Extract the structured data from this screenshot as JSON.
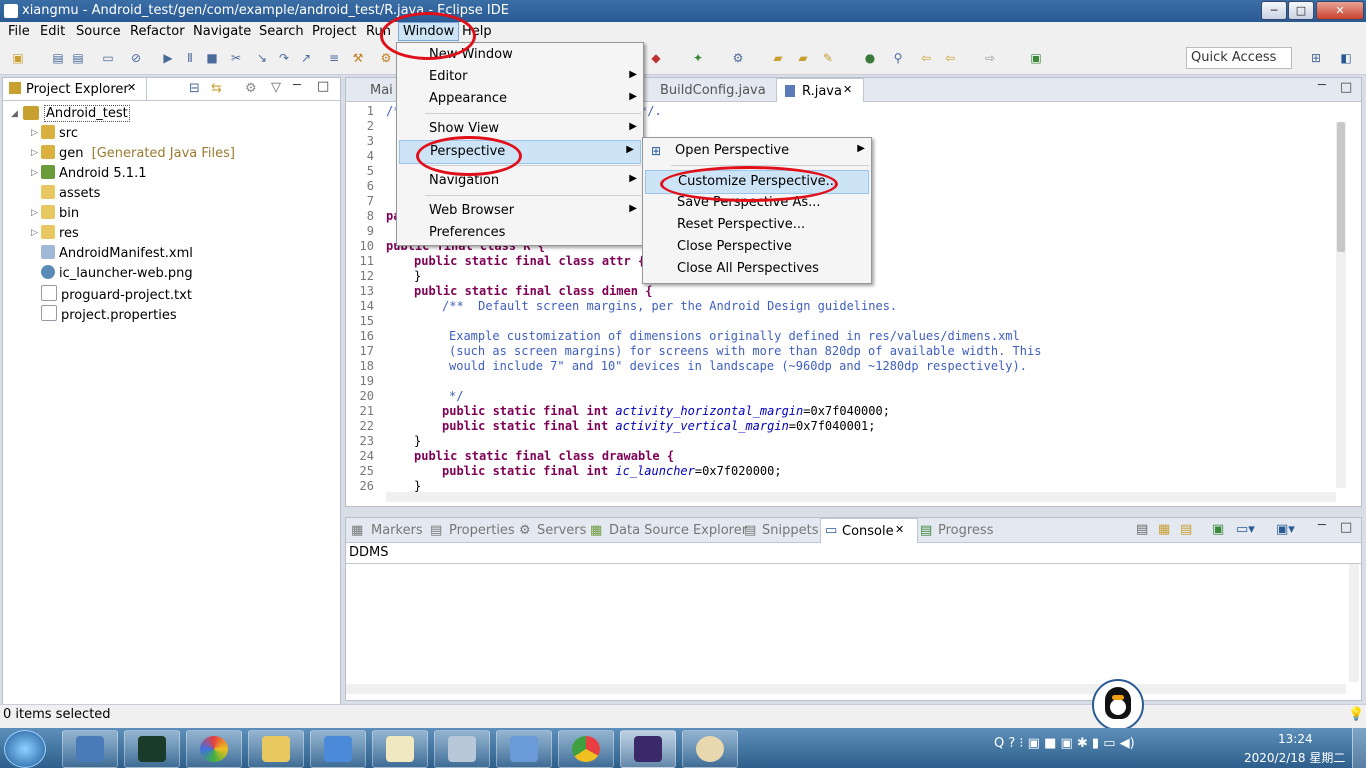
{
  "window": {
    "title": "xiangmu - Android_test/gen/com/example/android_test/R.java - Eclipse IDE",
    "minimize": "─",
    "maximize": "□",
    "close": "✕"
  },
  "menubar": [
    "File",
    "Edit",
    "Source",
    "Refactor",
    "Navigate",
    "Search",
    "Project",
    "Run",
    "Window",
    "Help"
  ],
  "toolbar": {
    "quick_access": "Quick Access"
  },
  "project_explorer": {
    "title": "Project Explorer",
    "project": "Android_test",
    "items": [
      {
        "label": "src",
        "extra": ""
      },
      {
        "label": "gen",
        "extra": "[Generated Java Files]"
      },
      {
        "label": "Android 5.1.1",
        "extra": ""
      },
      {
        "label": "assets",
        "extra": ""
      },
      {
        "label": "bin",
        "extra": ""
      },
      {
        "label": "res",
        "extra": ""
      },
      {
        "label": "AndroidManifest.xml",
        "extra": ""
      },
      {
        "label": "ic_launcher-web.png",
        "extra": ""
      },
      {
        "label": "proguard-project.txt",
        "extra": ""
      },
      {
        "label": "project.properties",
        "extra": ""
      }
    ]
  },
  "editor": {
    "tabs": [
      "Mai",
      "BuildConfig.java",
      "R.java"
    ],
    "line_numbers": [
      "1",
      "2",
      "3",
      "4",
      "5",
      "6",
      "7",
      "8",
      "9",
      "10",
      "11",
      "12",
      "13",
      "14",
      "15",
      "16",
      "17",
      "18",
      "19",
      "20",
      "21",
      "22",
      "23",
      "24",
      "25",
      "26"
    ],
    "lines": {
      "l1": "/**",
      "l1b": "*/.",
      "l8": "pa",
      "l10": "public final class R {",
      "l11": "public static final class attr {",
      "l12": "}",
      "l13": "public static final class dimen {",
      "l14": "/**  Default screen margins, per the Android Design guidelines.",
      "l16": "Example customization of dimensions originally defined in res/values/dimens.xml",
      "l17": "(such as screen margins) for screens with more than 820dp of available width. This",
      "l18": "would include 7\" and 10\" devices in landscape (~960dp and ~1280dp respectively).",
      "l20": "*/",
      "l21_field": "activity_horizontal_margin",
      "l21_val": "=0x7f040000;",
      "l22_field": "activity_vertical_margin",
      "l22_val": "=0x7f040001;",
      "l23": "}",
      "l24": "public static final class drawable {",
      "l25_field": "ic_launcher",
      "l25_val": "=0x7f020000;",
      "l26": "}",
      "kw_psfi": "public static final int"
    }
  },
  "window_menu": {
    "items": [
      {
        "label": "New Window",
        "submenu": false
      },
      {
        "label": "Editor",
        "submenu": true
      },
      {
        "label": "Appearance",
        "submenu": true
      },
      {
        "label": "Show View",
        "submenu": true
      },
      {
        "label": "Perspective",
        "submenu": true
      },
      {
        "label": "Navigation",
        "submenu": true
      },
      {
        "label": "Web Browser",
        "submenu": true
      },
      {
        "label": "Preferences",
        "submenu": false
      }
    ]
  },
  "perspective_menu": {
    "items": [
      {
        "label": "Open Perspective",
        "submenu": true
      },
      {
        "label": "Customize Perspective...",
        "submenu": false
      },
      {
        "label": "Save Perspective As...",
        "submenu": false
      },
      {
        "label": "Reset Perspective...",
        "submenu": false
      },
      {
        "label": "Close Perspective",
        "submenu": false
      },
      {
        "label": "Close All Perspectives",
        "submenu": false
      }
    ]
  },
  "bottom_panel": {
    "tabs": [
      "Markers",
      "Properties",
      "Servers",
      "Data Source Explorer",
      "Snippets",
      "Console",
      "Progress"
    ],
    "active_tab": "Console",
    "console_title": "DDMS"
  },
  "status": {
    "text": "0 items selected"
  },
  "tray": {
    "time": "13:24",
    "date": "2020/2/18 星期二"
  },
  "colors": {
    "annotation": "#e0101a",
    "menu_highlight": "#cde4f7"
  }
}
